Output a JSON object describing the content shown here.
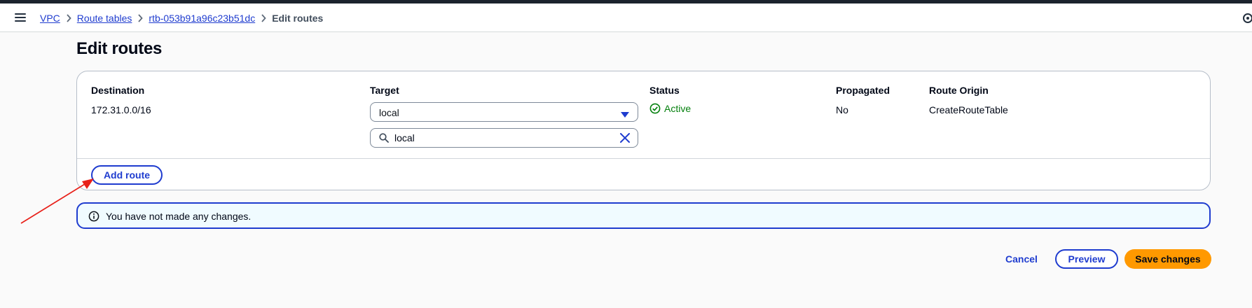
{
  "breadcrumb": {
    "items": [
      "VPC",
      "Route tables",
      "rtb-053b91a96c23b51dc"
    ],
    "current": "Edit routes"
  },
  "page": {
    "title": "Edit routes"
  },
  "routes": {
    "headers": {
      "destination": "Destination",
      "target": "Target",
      "status": "Status",
      "propagated": "Propagated",
      "route_origin": "Route Origin"
    },
    "rows": [
      {
        "destination": "172.31.0.0/16",
        "target": "local",
        "target_filter_value": "local",
        "status": "Active",
        "propagated": "No",
        "route_origin": "CreateRouteTable"
      }
    ],
    "add_route_label": "Add route"
  },
  "alert": {
    "message": "You have not made any changes.",
    "icon": "info-icon"
  },
  "actions": {
    "cancel": "Cancel",
    "preview": "Preview",
    "save": "Save changes"
  },
  "colors": {
    "link": "#1f3ccf",
    "success": "#037f0c",
    "primary_button": "#ff9900",
    "alert_background": "#f0fbff",
    "annotation_arrow": "#e8211a"
  }
}
